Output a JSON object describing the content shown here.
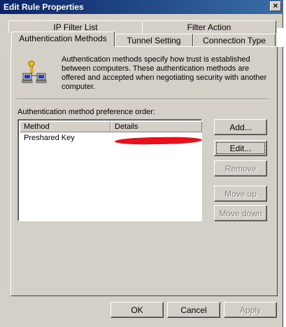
{
  "window": {
    "title": "Edit Rule Properties",
    "close_label": "×"
  },
  "tabs": {
    "row_back": [
      {
        "label": "IP Filter List"
      },
      {
        "label": "Filter Action"
      }
    ],
    "row_front": [
      {
        "label": "Authentication Methods",
        "active": true
      },
      {
        "label": "Tunnel Setting"
      },
      {
        "label": "Connection Type"
      }
    ]
  },
  "panel": {
    "description": "Authentication methods specify how trust is established between computers. These authentication methods are offered and accepted when negotiating security with another computer.",
    "list_label": "Authentication method preference order:",
    "columns": [
      "Method",
      "Details"
    ],
    "rows": [
      {
        "method": "Preshared Key",
        "details": ""
      }
    ],
    "buttons": {
      "add": "Add...",
      "edit": "Edit...",
      "remove": "Remove",
      "move_up": "Move up",
      "move_down": "Move down"
    }
  },
  "footer": {
    "ok": "OK",
    "cancel": "Cancel",
    "apply": "Apply"
  },
  "colors": {
    "title_bar_start": "#0a246a",
    "title_bar_end": "#3a6ea5",
    "dialog_face": "#d4d0c8",
    "redaction": "#e8101a"
  },
  "icons": {
    "auth_icon": "key-computers-icon",
    "close": "close-icon"
  }
}
